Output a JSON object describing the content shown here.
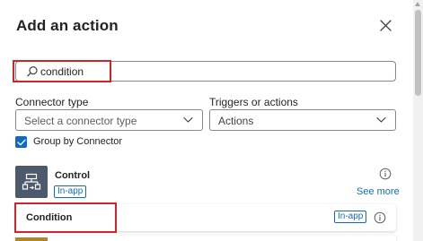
{
  "panel": {
    "title": "Add an action"
  },
  "search": {
    "value": "condition",
    "icon": "search-icon"
  },
  "filters": {
    "connector_type": {
      "label": "Connector type",
      "placeholder": "Select a connector type"
    },
    "triggers_actions": {
      "label": "Triggers or actions",
      "value": "Actions"
    },
    "group_by_connector": {
      "label": "Group by Connector",
      "checked": true
    }
  },
  "connector": {
    "name": "Control",
    "badge": "In-app",
    "see_more": "See more",
    "icon": "control-icon",
    "icon_color": "#4c5a6d"
  },
  "actions": [
    {
      "name": "Condition",
      "badge": "In-app"
    }
  ],
  "colors": {
    "accent": "#0f6cbd",
    "highlight": "#d1232a"
  }
}
